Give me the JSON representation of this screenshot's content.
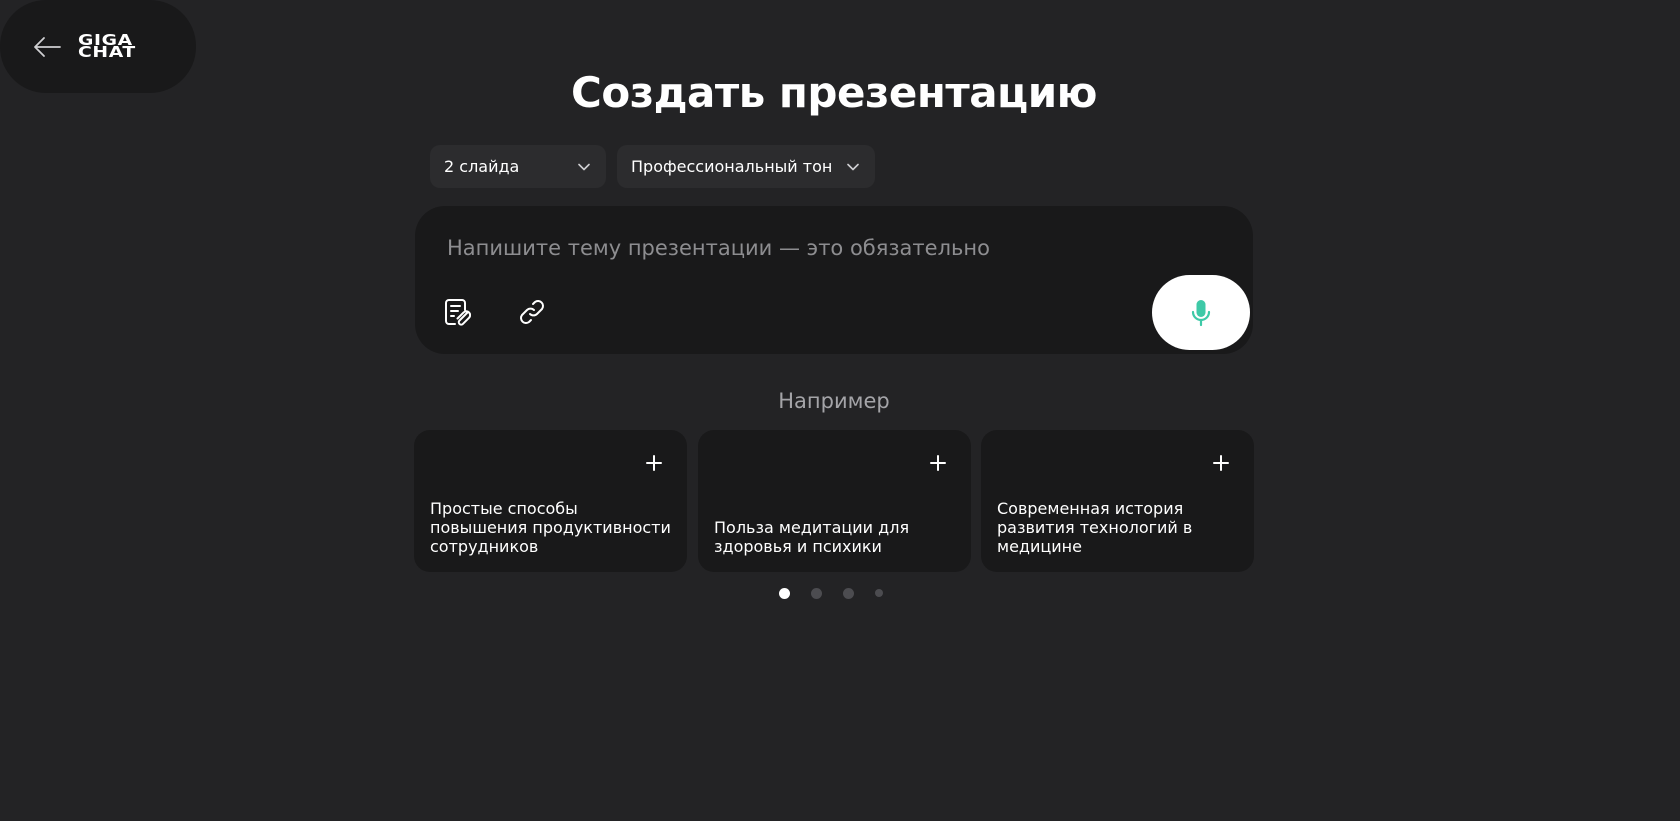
{
  "header": {
    "logo_line1": "GIGA",
    "logo_line2": "CHAT"
  },
  "main": {
    "title": "Создать презентацию",
    "slides_dropdown": "2 слайда",
    "tone_dropdown": "Профессиональный тон",
    "topic_placeholder": "Напишите тему презентации — это обязательно",
    "examples_label": "Например",
    "examples": [
      "Простые способы повышения продуктивности сотрудников",
      "Польза медитации для здоровья и психики",
      "Современная история развития технологий в медицине"
    ],
    "pagination": {
      "active_page": 1,
      "total_pages": 4
    }
  },
  "colors": {
    "background": "#232325",
    "panel": "#19191a",
    "dropdown": "#2c2c2e",
    "accent": "#3ec9a7",
    "mic_button": "#ffffff"
  },
  "icons": {
    "back": "arrow-left-icon",
    "chevron": "chevron-down-icon",
    "attach_doc": "document-attach-icon",
    "link": "link-icon",
    "mic": "microphone-icon",
    "add": "plus-icon"
  }
}
